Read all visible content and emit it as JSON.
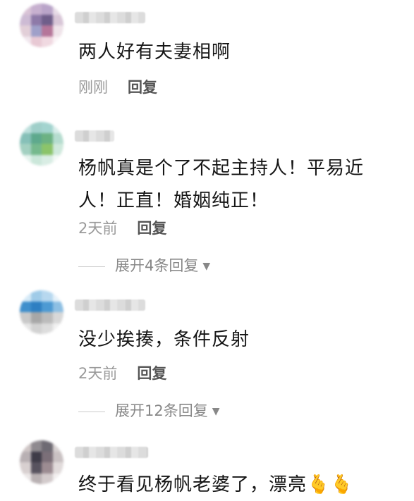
{
  "comments": [
    {
      "text": "两人好有夫妻相啊",
      "time": "刚刚",
      "reply_label": "回复",
      "expand_label": "",
      "avatar_colors": [
        "#d9c3d6",
        "#c7b0cf",
        "#b9a4c9",
        "#e7dbe6",
        "#cdbbd4",
        "#8e7aa8",
        "#6f5e8a",
        "#d8c6d7",
        "#e2cfd8",
        "#9fa0c9",
        "#b5769a",
        "#efe3e9",
        "#f1e7ee",
        "#e8c9d4",
        "#f0d9e1",
        "#faf3f6"
      ]
    },
    {
      "text": "杨帆真是个了不起主持人！平易近人！正直！婚姻纯正！",
      "time": "2天前",
      "reply_label": "回复",
      "expand_label": "展开4条回复",
      "avatar_colors": [
        "#bfe0dd",
        "#9fcfc9",
        "#a3d4cf",
        "#d7ece9",
        "#86c0b8",
        "#5ea98d",
        "#6cb283",
        "#b5dccf",
        "#a3d0c1",
        "#76b98e",
        "#8cc46a",
        "#cfe9dc",
        "#e6f3ee",
        "#cbe7da",
        "#d9ede4",
        "#f3f9f6"
      ]
    },
    {
      "text": "没少挨揍，条件反射",
      "time": "2天前",
      "reply_label": "回复",
      "expand_label": "展开12条回复",
      "avatar_colors": [
        "#d6eaf7",
        "#9fcbe8",
        "#b7d8ef",
        "#e5f1f9",
        "#3f8fcc",
        "#2e7fc2",
        "#4d9ad3",
        "#8dbfe3",
        "#c9c9c9",
        "#a7a7a7",
        "#bcbcbc",
        "#d8d8d8",
        "#e6e6e6",
        "#d2d2d2",
        "#dddddd",
        "#f1f1f1"
      ]
    },
    {
      "text": "终于看见杨帆老婆了，漂亮🫰🫰",
      "time": "",
      "reply_label": "",
      "expand_label": "",
      "avatar_colors": [
        "#cfc6c6",
        "#8f8a8f",
        "#6e6a73",
        "#d6d0d0",
        "#b8b0b3",
        "#3f3c48",
        "#7b6f78",
        "#c9c1c2",
        "#d8d0d0",
        "#58535f",
        "#9c8c92",
        "#e1dbdb",
        "#ece8e8",
        "#b9b1b3",
        "#d3cbcc",
        "#f2efef"
      ]
    }
  ]
}
